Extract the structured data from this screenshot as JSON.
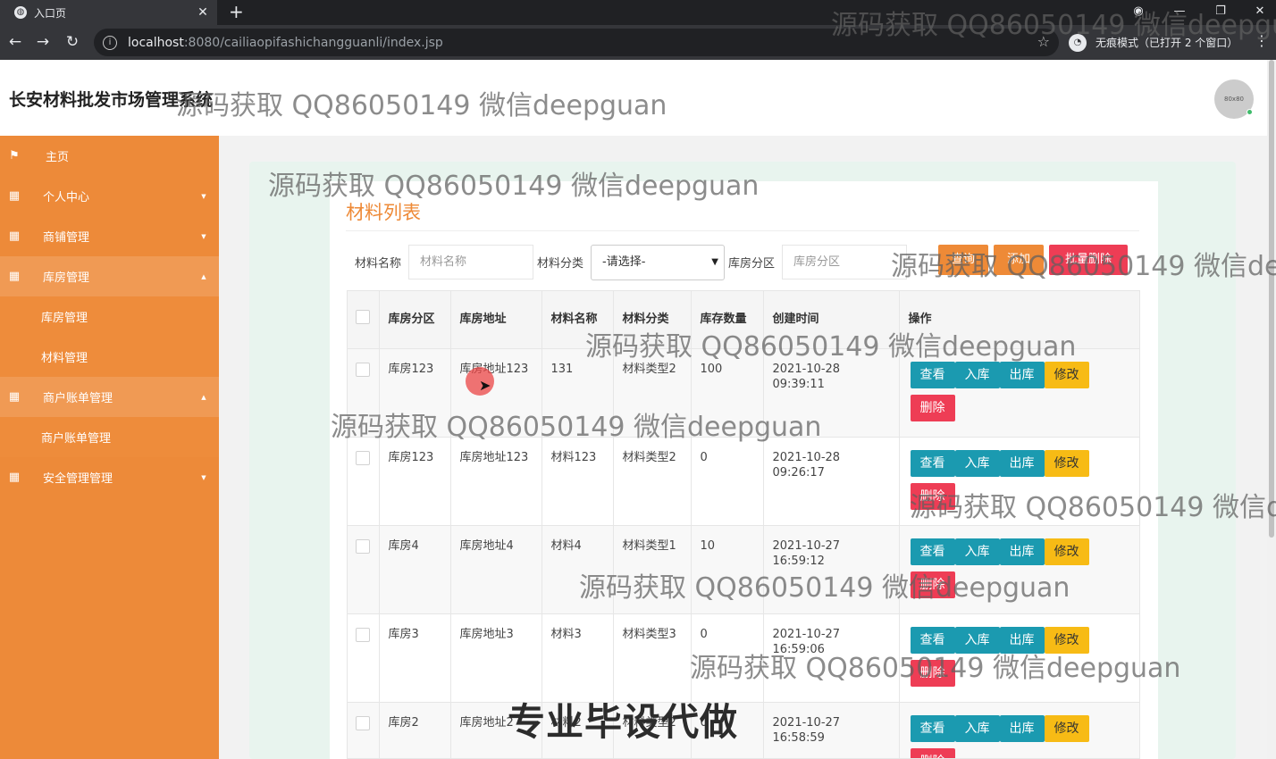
{
  "browser": {
    "tab_title": "入口页",
    "url_host": "localhost",
    "url_path": ":8080/cailiaopifashichangguanli/index.jsp",
    "incognito_label": "无痕模式（已打开 2 个窗口）"
  },
  "header": {
    "site_title": "长安材料批发市场管理系统",
    "avatar_text": "80x80"
  },
  "sidebar": {
    "items": [
      {
        "label": "主页",
        "icon": "flag-icon"
      },
      {
        "label": "个人中心",
        "icon": "grid-icon"
      },
      {
        "label": "商铺管理",
        "icon": "grid-icon"
      },
      {
        "label": "库房管理",
        "icon": "grid-icon"
      },
      {
        "label": "库房管理",
        "sub": true
      },
      {
        "label": "材料管理",
        "sub": true
      },
      {
        "label": "商户账单管理",
        "icon": "grid-icon"
      },
      {
        "label": "商户账单管理",
        "sub": true
      },
      {
        "label": "安全管理管理",
        "icon": "grid-icon"
      }
    ]
  },
  "panel": {
    "title": "材料列表",
    "filters": {
      "name_label": "材料名称",
      "name_placeholder": "材料名称",
      "category_label": "材料分类",
      "category_value": "-请选择-",
      "zone_label": "库房分区",
      "zone_placeholder": "库房分区"
    },
    "toolbar": {
      "search": "查询",
      "add": "添加",
      "batch_delete": "批量删除"
    },
    "table": {
      "headers": [
        "库房分区",
        "库房地址",
        "材料名称",
        "材料分类",
        "库存数量",
        "创建时间",
        "操作"
      ],
      "rows": [
        {
          "zone": "库房123",
          "address": "库房地址123",
          "name": "131",
          "category": "材料类型2",
          "qty": "100",
          "created": "2021-10-28 09:39:11"
        },
        {
          "zone": "库房123",
          "address": "库房地址123",
          "name": "材料123",
          "category": "材料类型2",
          "qty": "0",
          "created": "2021-10-28 09:26:17"
        },
        {
          "zone": "库房4",
          "address": "库房地址4",
          "name": "材料4",
          "category": "材料类型1",
          "qty": "10",
          "created": "2021-10-27 16:59:12"
        },
        {
          "zone": "库房3",
          "address": "库房地址3",
          "name": "材料3",
          "category": "材料类型3",
          "qty": "0",
          "created": "2021-10-27 16:59:06"
        },
        {
          "zone": "库房2",
          "address": "库房地址2",
          "name": "材料2",
          "category": "材料类型2",
          "qty": "0",
          "created": "2021-10-27 16:58:59"
        }
      ],
      "actions": {
        "view": "查看",
        "stock_in": "入库",
        "stock_out": "出库",
        "edit": "修改",
        "delete": "删除"
      }
    }
  },
  "watermarks": {
    "contact": "源码获取 QQ86050149 微信deepguan",
    "promo": "专业毕设代做"
  },
  "colors": {
    "sidebar": "#ed8a39",
    "accent": "#ee8a37",
    "info_button": "#1b9ab0",
    "warn_button": "#f7bb15",
    "danger_button": "#ee3d55"
  }
}
